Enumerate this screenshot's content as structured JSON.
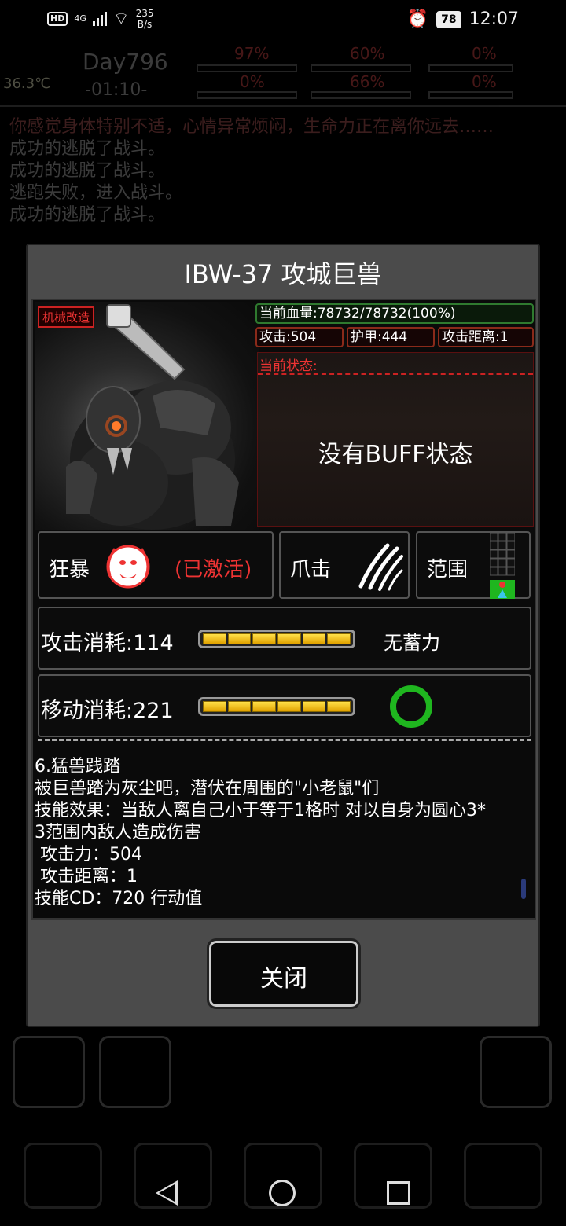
{
  "status_bar": {
    "hd": "HD",
    "signal": "4G",
    "speed_value": "235",
    "speed_unit": "B/s",
    "battery": "78",
    "time": "12:07"
  },
  "background": {
    "day": "Day796",
    "clock": "-01:10-",
    "temperature": "36.3℃",
    "pct_a": "97%",
    "pct_b": "60%",
    "pct_c": "0%",
    "pct_d": "0%",
    "pct_e": "66%",
    "pct_f": "0%",
    "log": [
      "你感觉身体特别不适，心情异常烦闷，生命力正在离你远去……",
      "成功的逃脱了战斗。",
      "成功的逃脱了战斗。",
      "逃跑失败，进入战斗。",
      "成功的逃脱了战斗。"
    ]
  },
  "dialog": {
    "title": "IBW-37 攻城巨兽",
    "tag": "机械改造",
    "hp": "当前血量:78732/78732(100%)",
    "attack": "攻击:504",
    "armor": "护甲:444",
    "range": "攻击距离:1",
    "status_header": "当前状态:",
    "no_buff": "没有BUFF状态",
    "skills": {
      "rage_label": "狂暴",
      "rage_state": "(已激活)",
      "claw_label": "爪击",
      "range_label": "范围"
    },
    "attack_cost": "攻击消耗:114",
    "attack_note": "无蓄力",
    "attack_charge_fraction": 1.0,
    "move_cost": "移动消耗:221",
    "move_charge_fraction": 1.0,
    "description": "6.猛兽践踏\n被巨兽踏为灰尘吧，潜伏在周围的\"小老鼠\"们\n技能效果：当敌人离自己小于等于1格时 对以自身为圆心3*\n3范围内敌人造成伤害\n 攻击力：504\n 攻击距离：1\n技能CD：720 行动值",
    "close": "关闭"
  },
  "colors": {
    "accent_red": "#e33333",
    "hp_green": "#2f7a2f",
    "bar_yellow": "#ffe14a",
    "ring_green": "#1fb61f"
  }
}
